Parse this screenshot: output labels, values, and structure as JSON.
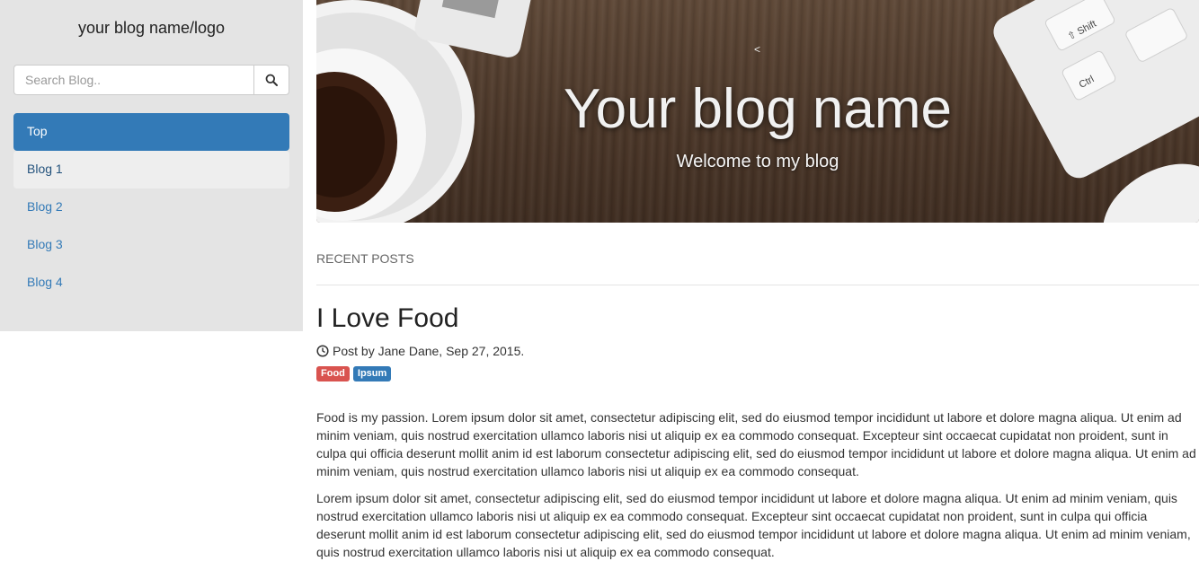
{
  "sidebar": {
    "logo": "your blog name/logo",
    "search": {
      "placeholder": "Search Blog..",
      "button_icon": "search-icon"
    },
    "nav": [
      {
        "label": "Top",
        "state": "active"
      },
      {
        "label": "Blog 1",
        "state": "hover"
      },
      {
        "label": "Blog 2",
        "state": "normal"
      },
      {
        "label": "Blog 3",
        "state": "normal"
      },
      {
        "label": "Blog 4",
        "state": "normal"
      }
    ]
  },
  "hero": {
    "chevron": "<",
    "title": "Your blog name",
    "subtitle": "Welcome to my blog"
  },
  "main": {
    "section_heading": "RECENT POSTS",
    "post": {
      "title": "I Love Food",
      "meta": "Post by Jane Dane, Sep 27, 2015.",
      "meta_icon": "clock-icon",
      "tags": [
        {
          "label": "Food",
          "color": "#d9534f"
        },
        {
          "label": "Ipsum",
          "color": "#337ab7"
        }
      ],
      "paragraphs": [
        "Food is my passion. Lorem ipsum dolor sit amet, consectetur adipiscing elit, sed do eiusmod tempor incididunt ut labore et dolore magna aliqua. Ut enim ad minim veniam, quis nostrud exercitation ullamco laboris nisi ut aliquip ex ea commodo consequat. Excepteur sint occaecat cupidatat non proident, sunt in culpa qui officia deserunt mollit anim id est laborum consectetur adipiscing elit, sed do eiusmod tempor incididunt ut labore et dolore magna aliqua. Ut enim ad minim veniam, quis nostrud exercitation ullamco laboris nisi ut aliquip ex ea commodo consequat.",
        "Lorem ipsum dolor sit amet, consectetur adipiscing elit, sed do eiusmod tempor incididunt ut labore et dolore magna aliqua. Ut enim ad minim veniam, quis nostrud exercitation ullamco laboris nisi ut aliquip ex ea commodo consequat. Excepteur sint occaecat cupidatat non proident, sunt in culpa qui officia deserunt mollit anim id est laborum consectetur adipiscing elit, sed do eiusmod tempor incididunt ut labore et dolore magna aliqua. Ut enim ad minim veniam, quis nostrud exercitation ullamco laboris nisi ut aliquip ex ea commodo consequat."
      ]
    }
  },
  "colors": {
    "accent": "#337ab7",
    "sidebar_bg": "#e4e4e4",
    "tag_food": "#d9534f",
    "tag_ipsum": "#337ab7"
  }
}
